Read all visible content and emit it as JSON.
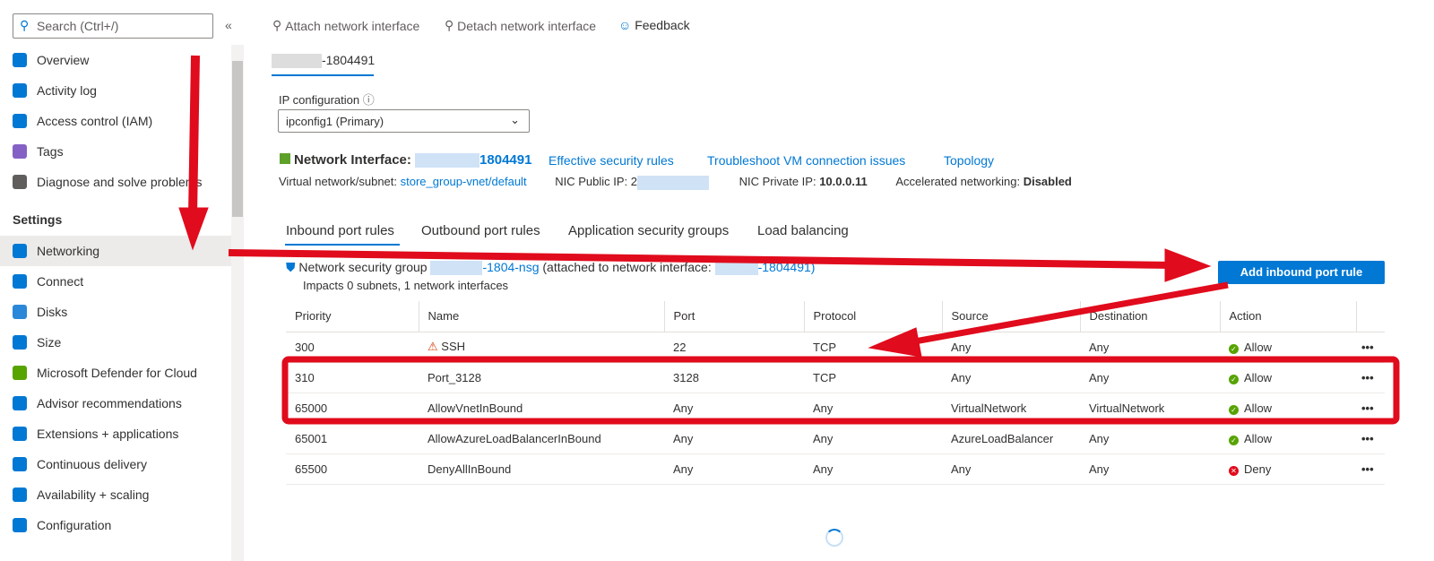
{
  "sidebar": {
    "search_placeholder": "Search (Ctrl+/)",
    "collapse": "«",
    "items": [
      "Overview",
      "Activity log",
      "Access control (IAM)",
      "Tags",
      "Diagnose and solve problems"
    ],
    "section": "Settings",
    "settings_items": [
      "Networking",
      "Connect",
      "Disks",
      "Size",
      "Microsoft Defender for Cloud",
      "Advisor recommendations",
      "Extensions + applications",
      "Continuous delivery",
      "Availability + scaling",
      "Configuration"
    ]
  },
  "toolbar": {
    "attach": "Attach network interface",
    "detach": "Detach network interface",
    "feedback": "Feedback"
  },
  "nic_tab": "-1804491",
  "ipconfig": {
    "label": "IP configuration",
    "value": "ipconfig1 (Primary)"
  },
  "nic": {
    "label": "Network Interface:",
    "name": "1804491",
    "links": [
      "Effective security rules",
      "Troubleshoot VM connection issues",
      "Topology"
    ],
    "vnet_label": "Virtual network/subnet:",
    "vnet": "store_group-vnet/default",
    "public_ip_label": "NIC Public IP:",
    "public_ip": "2",
    "private_ip_label": "NIC Private IP:",
    "private_ip": "10.0.0.11",
    "accel_label": "Accelerated networking:",
    "accel": "Disabled"
  },
  "tabs": [
    "Inbound port rules",
    "Outbound port rules",
    "Application security groups",
    "Load balancing"
  ],
  "nsg": {
    "prefix": "Network security group",
    "name": "-1804-nsg",
    "attached": "(attached to network interface:",
    "attached_name": "-1804491)",
    "impacts": "Impacts 0 subnets, 1 network interfaces"
  },
  "add_button": "Add inbound port rule",
  "table": {
    "headers": [
      "Priority",
      "Name",
      "Port",
      "Protocol",
      "Source",
      "Destination",
      "Action"
    ],
    "rows": [
      [
        "300",
        "SSH",
        "22",
        "TCP",
        "Any",
        "Any",
        "Allow"
      ],
      [
        "310",
        "Port_3128",
        "3128",
        "TCP",
        "Any",
        "Any",
        "Allow"
      ],
      [
        "65000",
        "AllowVnetInBound",
        "Any",
        "Any",
        "VirtualNetwork",
        "VirtualNetwork",
        "Allow"
      ],
      [
        "65001",
        "AllowAzureLoadBalancerInBound",
        "Any",
        "Any",
        "AzureLoadBalancer",
        "Any",
        "Allow"
      ],
      [
        "65500",
        "DenyAllInBound",
        "Any",
        "Any",
        "Any",
        "Any",
        "Deny"
      ]
    ],
    "more": "•••"
  },
  "colors": {
    "accent": "#0078d4",
    "annotation": "#e00b1c"
  }
}
